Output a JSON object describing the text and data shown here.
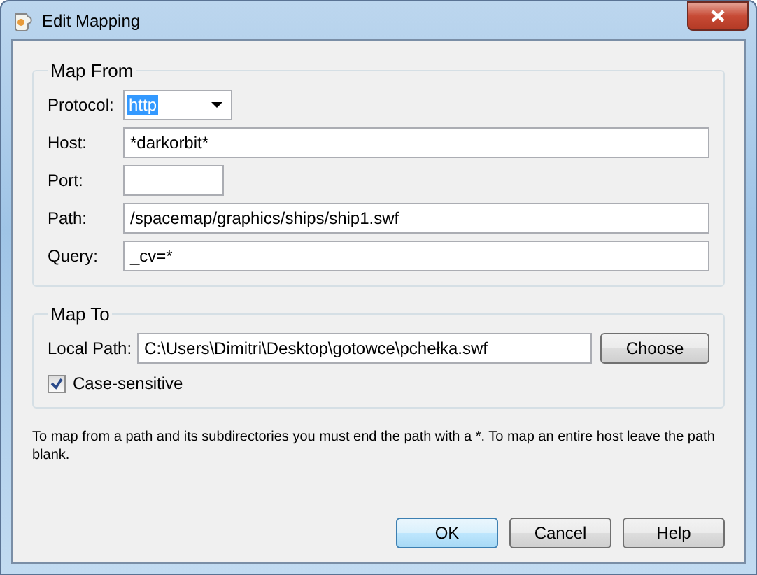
{
  "window": {
    "title": "Edit Mapping"
  },
  "map_from": {
    "title": "Map From",
    "fields": [
      {
        "kind": "dropdown",
        "label": "Protocol:",
        "value": "http"
      },
      {
        "kind": "text",
        "label": "Host:",
        "value": "*darkorbit*"
      },
      {
        "kind": "short",
        "label": "Port:"
      },
      {
        "kind": "text",
        "label": "Path:",
        "value": "/spacemap/graphics/ships/ship1.swf"
      },
      {
        "kind": "text",
        "label": "Query:",
        "value": "_cv=*"
      }
    ]
  },
  "map_to": {
    "title": "Map To",
    "local_path_label": "Local Path:",
    "local_path": "C:\\Users\\Dimitri\\Desktop\\gotowce\\pchełka.swf",
    "choose_button": "Choose",
    "case_sensitive": {
      "label": "Case-sensitive",
      "checked": true
    }
  },
  "note": "To map from a path and its subdirectories you must end the path with a *. To map an entire host leave the path blank.",
  "buttons": [
    {
      "label": "OK",
      "default": true
    },
    {
      "label": "Cancel",
      "default": false
    },
    {
      "label": "Help",
      "default": false
    }
  ]
}
